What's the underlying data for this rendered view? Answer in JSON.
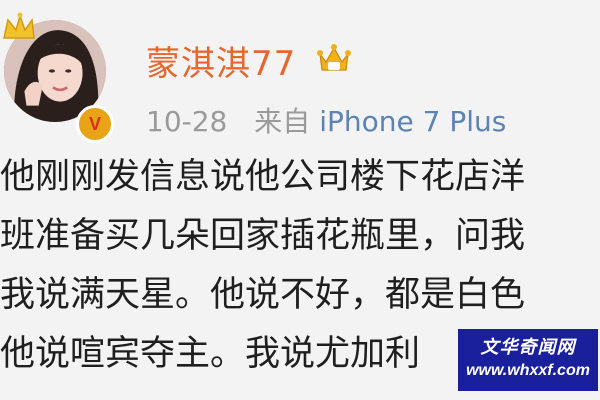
{
  "post": {
    "author": {
      "name": "蒙淇淇77",
      "avatar_icon": "avatar-photo",
      "verified_badge": "V",
      "verified_icon": "verified-badge-icon",
      "member_icon": "vip-crown-icon"
    },
    "meta": {
      "time": "10-28",
      "source_prefix": "来自",
      "source_device": "iPhone 7 Plus"
    },
    "content_lines": [
      "他刚刚发信息说他公司楼下花店洋",
      "班准备买几朵回家插花瓶里，问我",
      "我说满天星。他说不好，都是白色",
      "他说喧宾夺主。我说尤加利"
    ]
  },
  "watermark": {
    "title": "文华奇闻网",
    "url": "www.whxxf.com"
  },
  "colors": {
    "username": "#e5672e",
    "meta": "#9a9a9a",
    "source_link": "#5b83b3",
    "badge_gold": "#e8a317",
    "watermark_bg": "#1a1f9c"
  }
}
